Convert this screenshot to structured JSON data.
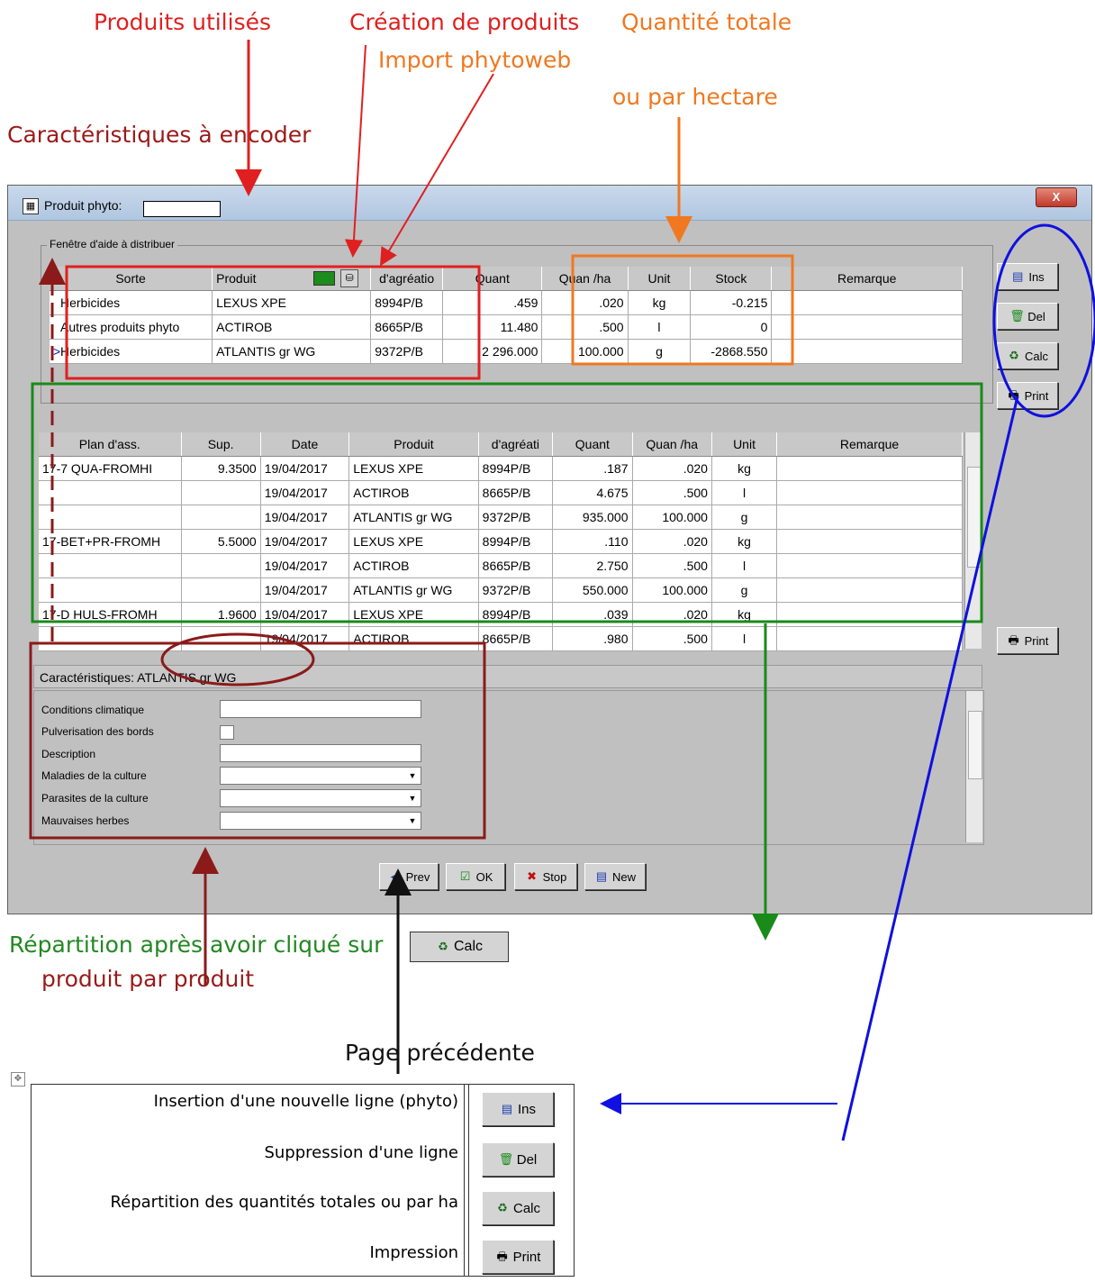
{
  "annotations": {
    "produits_utilises": "Produits utilisés",
    "creation_produits": "Création de produits",
    "quantite_totale": "Quantité totale",
    "import_phytoweb": "Import phytoweb",
    "par_hectare": "ou par hectare",
    "caracteristiques_encoder": "Caractéristiques à encoder",
    "repartition": "Répartition après avoir cliqué sur",
    "repartition_calc": "Calc",
    "produit_par_produit": "produit par produit",
    "page_precedente": "Page précédente"
  },
  "window": {
    "title": "Produit phyto:",
    "close": "X",
    "group_label": "Fenêtre d'aide à distribuer"
  },
  "top_table": {
    "headers": [
      "Sorte",
      "Produit",
      "d'agréatio",
      "Quant",
      "Quan /ha",
      "Unit",
      "Stock",
      "Remarque"
    ],
    "rows": [
      {
        "marker": "",
        "sorte": "Herbicides",
        "produit": "LEXUS XPE",
        "agreation": "8994P/B",
        "quant": ".459",
        "quan_ha": ".020",
        "unit": "kg",
        "stock": "-0.215",
        "remarque": ""
      },
      {
        "marker": "",
        "sorte": "Autres produits phyto",
        "produit": "ACTIROB",
        "agreation": "8665P/B",
        "quant": "11.480",
        "quan_ha": ".500",
        "unit": "l",
        "stock": "0",
        "remarque": ""
      },
      {
        "marker": ">",
        "sorte": "Herbicides",
        "produit": "ATLANTIS gr WG",
        "agreation": "9372P/B",
        "quant": "2 296.000",
        "quan_ha": "100.000",
        "unit": "g",
        "stock": "-2868.550",
        "remarque": ""
      }
    ]
  },
  "side_buttons": {
    "ins": "Ins",
    "del": "Del",
    "calc": "Calc",
    "print": "Print",
    "print2": "Print"
  },
  "repartition_table": {
    "headers": [
      "Plan d'ass.",
      "Sup.",
      "Date",
      "Produit",
      "d'agréati",
      "Quant",
      "Quan /ha",
      "Unit",
      "Remarque"
    ],
    "rows": [
      {
        "plan": "17-7 QUA-FROMHI",
        "sup": "9.3500",
        "date": "19/04/2017",
        "produit": "LEXUS XPE",
        "agr": "8994P/B",
        "quant": ".187",
        "qha": ".020",
        "unit": "kg"
      },
      {
        "plan": "",
        "sup": "",
        "date": "19/04/2017",
        "produit": "ACTIROB",
        "agr": "8665P/B",
        "quant": "4.675",
        "qha": ".500",
        "unit": "l"
      },
      {
        "plan": "",
        "sup": "",
        "date": "19/04/2017",
        "produit": "ATLANTIS gr WG",
        "agr": "9372P/B",
        "quant": "935.000",
        "qha": "100.000",
        "unit": "g"
      },
      {
        "plan": "17-BET+PR-FROMH",
        "sup": "5.5000",
        "date": "19/04/2017",
        "produit": "LEXUS XPE",
        "agr": "8994P/B",
        "quant": ".110",
        "qha": ".020",
        "unit": "kg"
      },
      {
        "plan": "",
        "sup": "",
        "date": "19/04/2017",
        "produit": "ACTIROB",
        "agr": "8665P/B",
        "quant": "2.750",
        "qha": ".500",
        "unit": "l"
      },
      {
        "plan": "",
        "sup": "",
        "date": "19/04/2017",
        "produit": "ATLANTIS gr WG",
        "agr": "9372P/B",
        "quant": "550.000",
        "qha": "100.000",
        "unit": "g"
      },
      {
        "plan": "17-D HULS-FROMH",
        "sup": "1.9600",
        "date": "19/04/2017",
        "produit": "LEXUS XPE",
        "agr": "8994P/B",
        "quant": ".039",
        "qha": ".020",
        "unit": "kg"
      },
      {
        "plan": "",
        "sup": "",
        "date": "19/04/2017",
        "produit": "ACTIROB",
        "agr": "8665P/B",
        "quant": ".980",
        "qha": ".500",
        "unit": "l"
      }
    ]
  },
  "characteristics": {
    "title": "Caractéristiques:",
    "product": "ATLANTIS gr WG",
    "fields": {
      "conditions": "Conditions climatique",
      "pulverisation": "Pulverisation des bords",
      "description": "Description",
      "maladies": "Maladies de la culture",
      "parasites": "Parasites de la culture",
      "mauvaises": "Mauvaises herbes"
    }
  },
  "bottom_buttons": {
    "prev": "Prev",
    "ok": "OK",
    "stop": "Stop",
    "new": "New"
  },
  "legend": {
    "ins_text": "Insertion d'une nouvelle ligne (phyto)",
    "del_text": "Suppression d'une ligne",
    "calc_text": "Répartition des quantités totales ou par ha",
    "print_text": "Impression",
    "ins": "Ins",
    "del": "Del",
    "calc": "Calc",
    "print": "Print"
  },
  "colors": {
    "red": "#e02020",
    "orange": "#f07820",
    "maroon": "#8b1a1a",
    "green": "#1a8a1a",
    "blue": "#1010e0"
  }
}
